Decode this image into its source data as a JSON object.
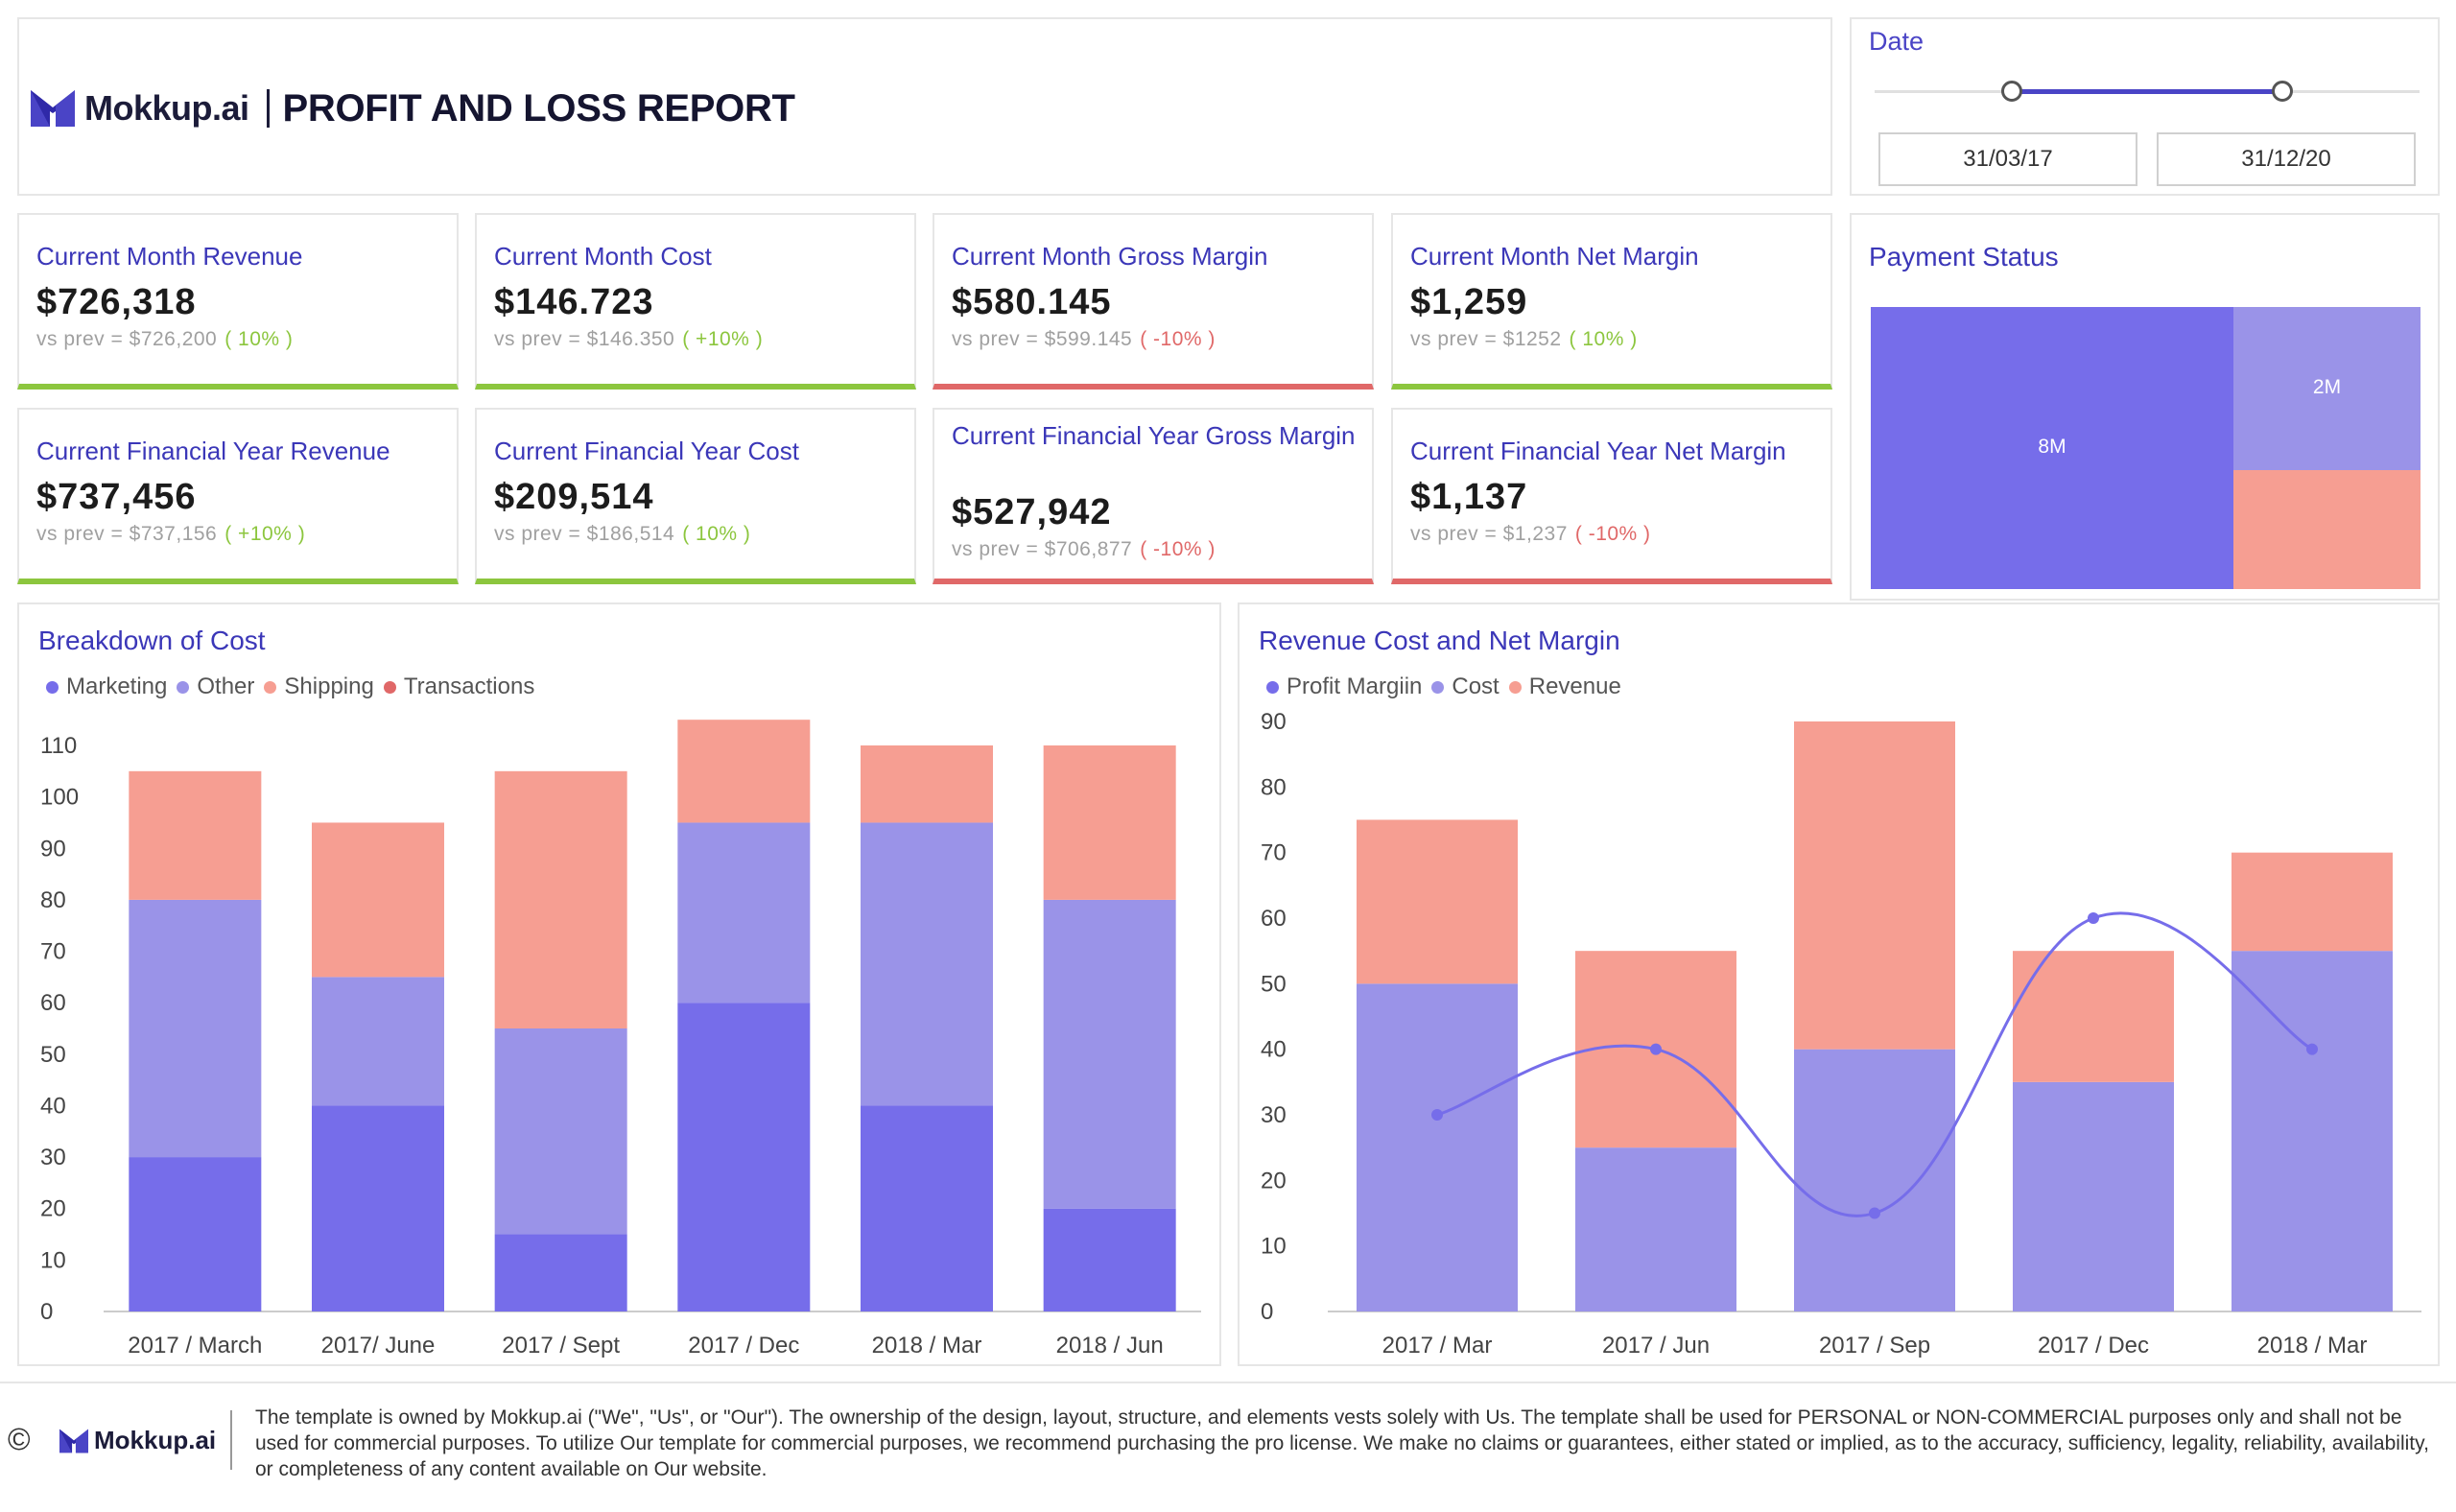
{
  "header": {
    "brand": "Mokkup.ai",
    "title": "PROFIT AND LOSS REPORT"
  },
  "date_filter": {
    "label": "Date",
    "start": "31/03/17",
    "end": "31/12/20"
  },
  "kpis": [
    {
      "title": "Current Month Revenue",
      "value": "$726,318",
      "prev_label": "vs prev =",
      "prev_value": "$726,200",
      "pct": "( 10% )",
      "trend": "positive"
    },
    {
      "title": "Current Month Cost",
      "value": "$146.723",
      "prev_label": "vs prev =",
      "prev_value": "$146.350",
      "pct": "( +10% )",
      "trend": "positive"
    },
    {
      "title": "Current Month Gross Margin",
      "value": "$580.145",
      "prev_label": "vs prev =",
      "prev_value": "$599.145",
      "pct": "( -10% )",
      "trend": "negative"
    },
    {
      "title": "Current Month Net Margin",
      "value": "$1,259",
      "prev_label": "vs prev =",
      "prev_value": "$1252",
      "pct": "( 10% )",
      "trend": "positive"
    },
    {
      "title": "Current Financial Year Revenue",
      "value": "$737,456",
      "prev_label": "vs prev =",
      "prev_value": "$737,156",
      "pct": "( +10% )",
      "trend": "positive"
    },
    {
      "title": "Current Financial Year Cost",
      "value": "$209,514",
      "prev_label": "vs prev =",
      "prev_value": "$186,514",
      "pct": "( 10% )",
      "trend": "positive"
    },
    {
      "title": "Current Financial Year Gross Margin",
      "value": "$527,942",
      "prev_label": "vs prev =",
      "prev_value": "$706,877",
      "pct": "( -10% )",
      "trend": "negative"
    },
    {
      "title": "Current Financial Year Net Margin",
      "value": "$1,137",
      "prev_label": "vs prev =",
      "prev_value": "$1,237",
      "pct": "( -10% )",
      "trend": "negative"
    }
  ],
  "payment_status": {
    "title": "Payment Status",
    "tiles": [
      {
        "label": "8M",
        "color": "#766dea"
      },
      {
        "label": "2M",
        "color": "#9a93e8"
      },
      {
        "label": "",
        "color": "#f69e92"
      }
    ]
  },
  "colors": {
    "accent": "#3b37b8",
    "positive": "#8cc63e",
    "negative": "#e06868",
    "marketing": "#766dea",
    "other": "#9a93e8",
    "shipping": "#f69e92",
    "transactions": "#e06868"
  },
  "chart_data": [
    {
      "type": "bar",
      "stacked": true,
      "title": "Breakdown of Cost",
      "legend": [
        "Marketing",
        "Other",
        "Shipping",
        "Transactions"
      ],
      "legend_colors": [
        "#766dea",
        "#9a93e8",
        "#f69e92",
        "#e06868"
      ],
      "categories": [
        "2017 / March",
        "2017/ June",
        "2017 / Sept",
        "2017 / Dec",
        "2018 / Mar",
        "2018 / Jun"
      ],
      "series": [
        {
          "name": "Marketing",
          "color": "#766dea",
          "values": [
            30,
            40,
            15,
            60,
            40,
            20
          ]
        },
        {
          "name": "Other",
          "color": "#9a93e8",
          "values": [
            50,
            25,
            40,
            35,
            55,
            60
          ]
        },
        {
          "name": "Shipping",
          "color": "#f69e92",
          "values": [
            25,
            30,
            50,
            20,
            15,
            30
          ]
        }
      ],
      "ylim": [
        0,
        110
      ],
      "yticks": [
        0,
        10,
        20,
        30,
        40,
        50,
        60,
        70,
        80,
        90,
        100,
        110
      ],
      "grid": false,
      "legend_position": "top-left"
    },
    {
      "type": "bar",
      "stacked": true,
      "title": "Revenue Cost and Net Margin",
      "legend": [
        "Profit Margiin",
        "Cost",
        "Revenue"
      ],
      "legend_colors": [
        "#766dea",
        "#9a93e8",
        "#f69e92"
      ],
      "categories": [
        "2017 / Mar",
        "2017 / Jun",
        "2017 / Sep",
        "2017 / Dec",
        "2018 / Mar"
      ],
      "series": [
        {
          "name": "Cost",
          "color": "#9a93e8",
          "values": [
            50,
            25,
            40,
            35,
            55
          ]
        },
        {
          "name": "Revenue",
          "color": "#f69e92",
          "values": [
            25,
            30,
            50,
            20,
            15
          ]
        }
      ],
      "line_series": {
        "name": "Profit Margiin",
        "color": "#766dea",
        "values": [
          30,
          40,
          15,
          60,
          40
        ]
      },
      "ylim": [
        0,
        90
      ],
      "yticks": [
        0,
        10,
        20,
        30,
        40,
        50,
        60,
        70,
        80,
        90
      ],
      "grid": false,
      "legend_position": "top-left"
    }
  ],
  "footer": {
    "copyright_icon": "©",
    "brand": "Mokkup.ai",
    "text": "The template is owned by Mokkup.ai (\"We\", \"Us\", or \"Our\"). The ownership of the design, layout, structure, and elements vests solely with Us. The template shall be used for PERSONAL or NON-COMMERCIAL purposes only and shall not be used for commercial purposes. To utilize Our template for commercial purposes, we recommend purchasing the pro license. We make no claims or guarantees, either stated or implied, as to the accuracy, sufficiency, legality, reliability, availability, or completeness of any content available on Our website."
  }
}
